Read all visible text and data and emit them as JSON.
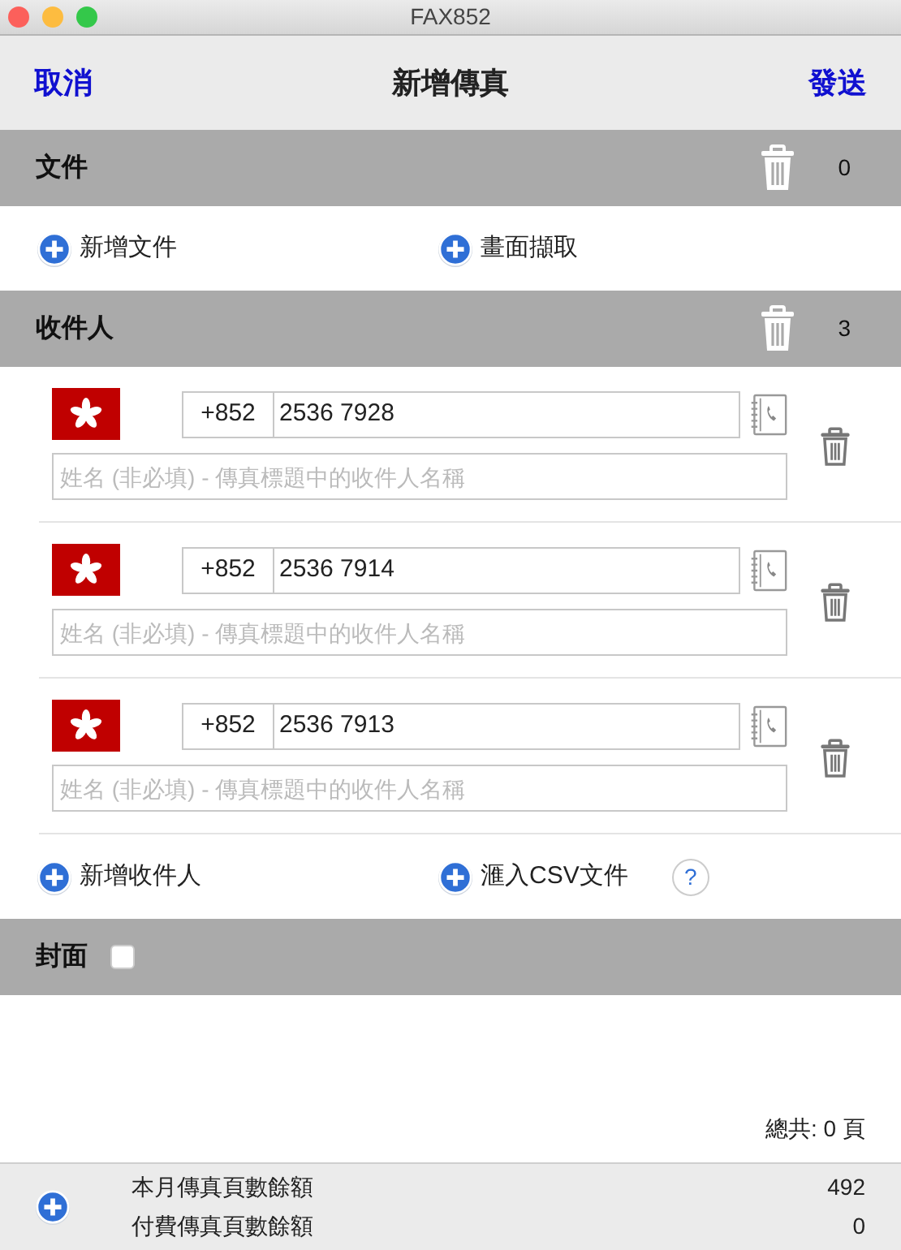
{
  "window": {
    "title": "FAX852"
  },
  "toolbar": {
    "cancel": "取消",
    "title": "新增傳真",
    "send": "發送"
  },
  "documents": {
    "title": "文件",
    "count": "0",
    "actions": [
      "新增文件",
      "畫面擷取"
    ]
  },
  "recipients": {
    "title": "收件人",
    "count": "3",
    "items": [
      {
        "country_code": "+852",
        "number": "2536 7928",
        "name_placeholder": "姓名 (非必填) - 傳真標題中的收件人名稱"
      },
      {
        "country_code": "+852",
        "number": "2536 7914",
        "name_placeholder": "姓名 (非必填) - 傳真標題中的收件人名稱"
      },
      {
        "country_code": "+852",
        "number": "2536 7913",
        "name_placeholder": "姓名 (非必填) - 傳真標題中的收件人名稱"
      }
    ],
    "actions": [
      "新增收件人",
      "滙入CSV文件"
    ],
    "help": "?"
  },
  "cover": {
    "title": "封面",
    "checked": false
  },
  "total": "總共: 0 頁",
  "footer": {
    "rows": [
      {
        "label": "本月傳真頁數餘額",
        "value": "492"
      },
      {
        "label": "付費傳真頁數餘額",
        "value": "0"
      }
    ]
  }
}
